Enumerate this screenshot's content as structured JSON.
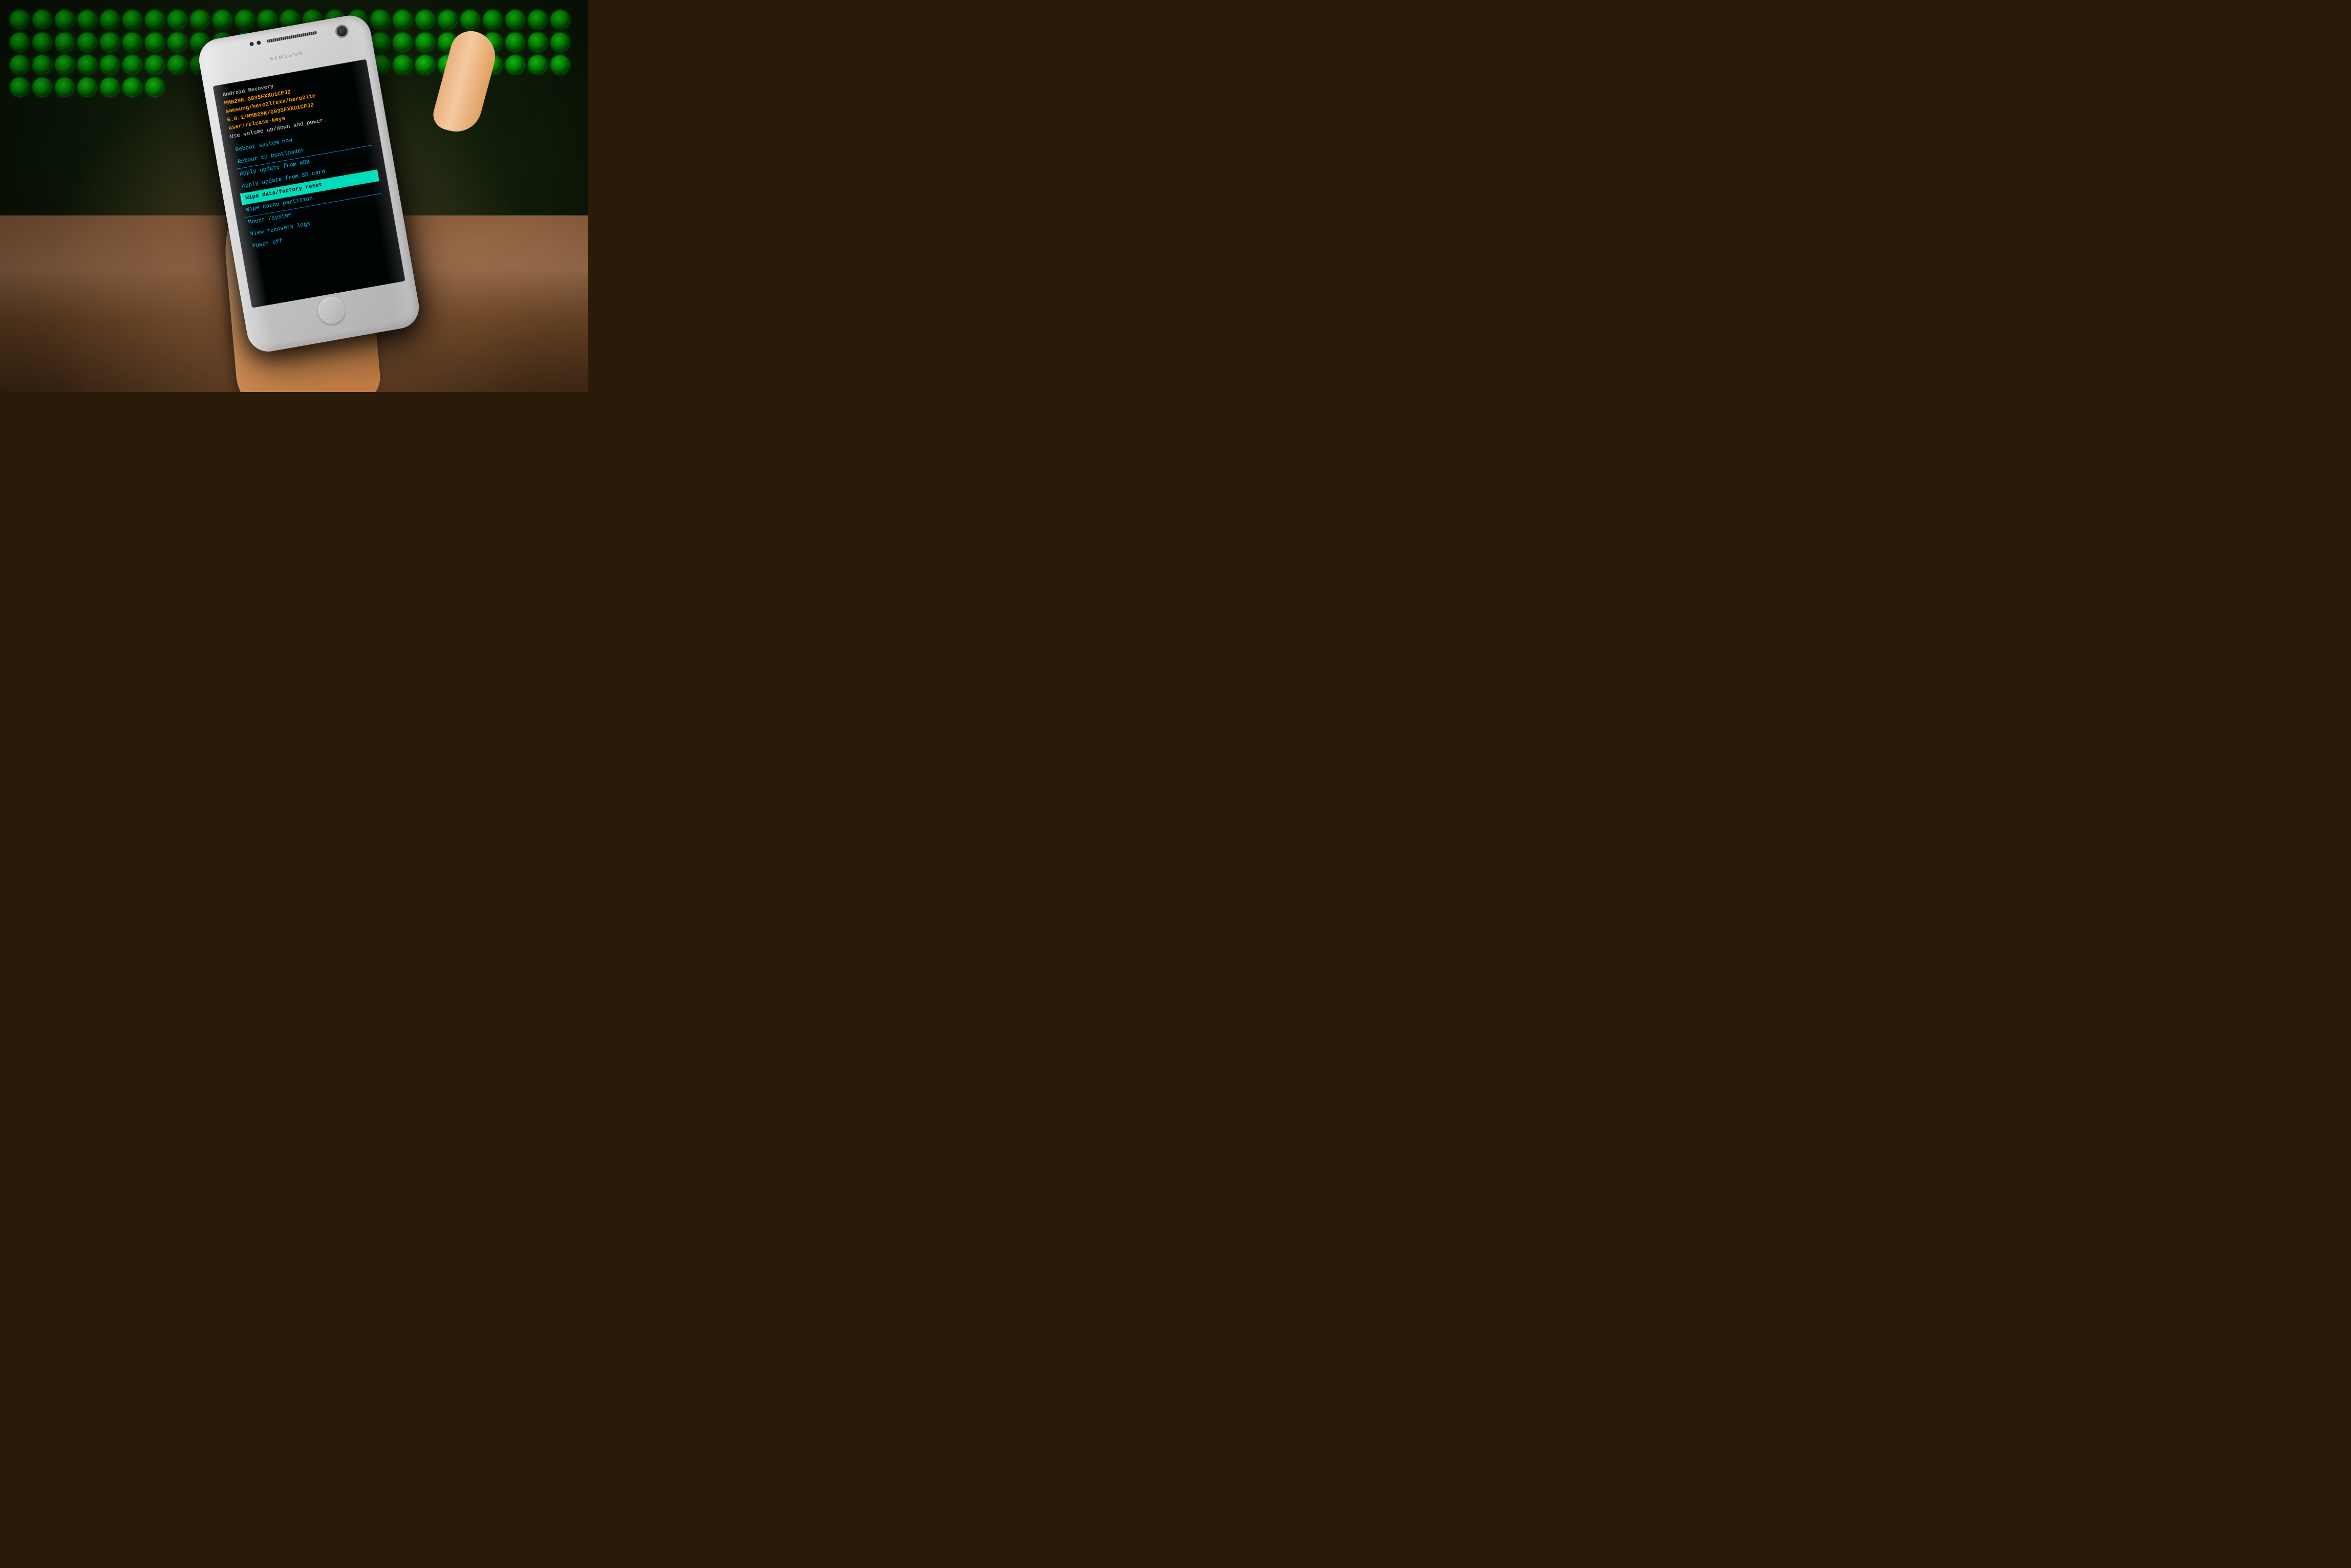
{
  "scene": {
    "phone": {
      "brand": "SAMSUNG",
      "screen": {
        "header": {
          "line1": "Android Recovery",
          "line2": "MMB29K.G935FXXU1CPJ2",
          "line3": "samsung/hero2ltexx/hero2lte",
          "line4": "6.0.1/MMB29K/G935FXXU1CPJ2",
          "line5": "user/release-keys",
          "line6": "Use volume up/down and power."
        },
        "menu_items": [
          {
            "label": "Reboot system now",
            "selected": false
          },
          {
            "label": "Reboot to bootloader",
            "selected": false
          },
          {
            "label": "Apply update from ADB",
            "selected": false
          },
          {
            "label": "Apply update from SD card",
            "selected": false
          },
          {
            "label": "Wipe data/factory reset",
            "selected": true
          },
          {
            "label": "Wipe cache partition",
            "selected": false
          },
          {
            "label": "Mount /system",
            "selected": false
          },
          {
            "label": "View recovery logs",
            "selected": false
          },
          {
            "label": "Power off",
            "selected": false
          }
        ]
      }
    }
  }
}
